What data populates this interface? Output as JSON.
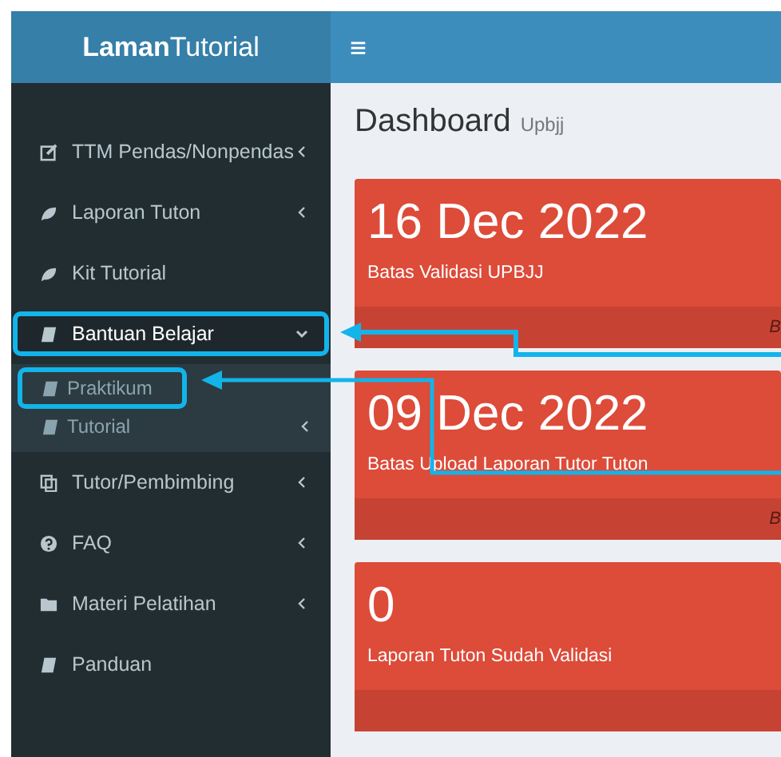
{
  "brand": {
    "bold": "Laman",
    "light": "Tutorial"
  },
  "menu_toggle": "≡",
  "sidebar": {
    "items": [
      {
        "label": "TTM Pendas/Nonpendas",
        "expanded": false,
        "annotated": false
      },
      {
        "label": "Laporan Tuton",
        "expanded": false,
        "annotated": false
      },
      {
        "label": "Kit Tutorial",
        "annotated": false
      },
      {
        "label": "Bantuan Belajar",
        "expanded": true,
        "annotated": true,
        "children": [
          {
            "label": "Praktikum",
            "annotated": true
          },
          {
            "label": "Tutorial",
            "expanded": false,
            "annotated": false
          }
        ]
      },
      {
        "label": "Tutor/Pembimbing",
        "expanded": false,
        "annotated": false
      },
      {
        "label": "FAQ",
        "expanded": false,
        "annotated": false
      },
      {
        "label": "Materi Pelatihan",
        "expanded": false,
        "annotated": false
      },
      {
        "label": "Panduan",
        "annotated": false
      }
    ]
  },
  "page_header": {
    "title": "Dashboard",
    "subtitle": "Upbjj"
  },
  "cards": [
    {
      "value": "16 Dec 2022",
      "label": "Batas Validasi UPBJJ",
      "footer": "B"
    },
    {
      "value": "09 Dec 2022",
      "label": "Batas Upload Laporan Tutor Tuton",
      "footer": "B"
    },
    {
      "value": "0",
      "label": "Laporan Tuton Sudah Validasi"
    }
  ]
}
